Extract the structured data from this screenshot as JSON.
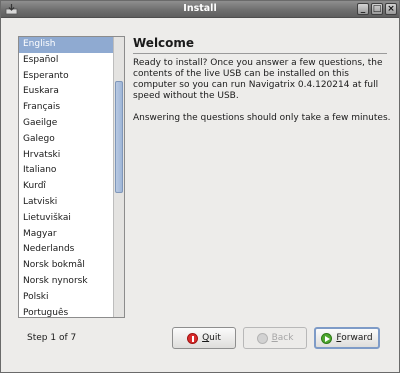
{
  "window": {
    "title": "Install"
  },
  "languages": {
    "selected_index": 0,
    "items": [
      "English",
      "Español",
      "Esperanto",
      "Euskara",
      "Français",
      "Gaeilge",
      "Galego",
      "Hrvatski",
      "Italiano",
      "Kurdî",
      "Latviski",
      "Lietuviškai",
      "Magyar",
      "Nederlands",
      "Norsk bokmål",
      "Norsk nynorsk",
      "Polski",
      "Português"
    ]
  },
  "content": {
    "heading": "Welcome",
    "paragraph1": "Ready to install?  Once you answer a few questions, the contents of the live USB can be installed on this computer so you can run Navigatrix 0.4.120214 at full speed without the USB.",
    "paragraph2": "Answering the questions should only take a few minutes."
  },
  "footer": {
    "step": "Step 1 of 7",
    "quit_label": "Quit",
    "back_label": "Back",
    "forward_label": "Forward"
  },
  "icons": {
    "app": "installer-icon",
    "quit": "quit-icon",
    "back": "back-arrow-icon",
    "forward": "forward-arrow-icon"
  }
}
